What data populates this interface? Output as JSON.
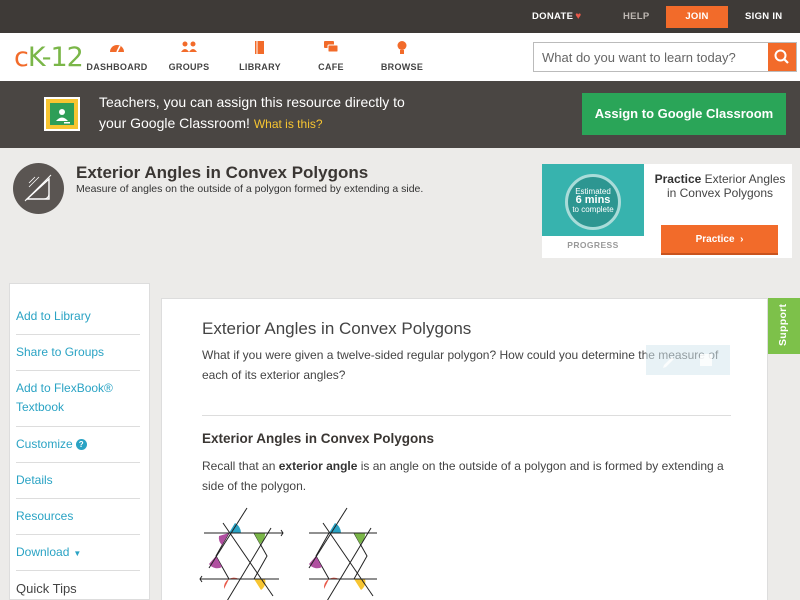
{
  "topbar": {
    "donate": "DONATE",
    "help": "HELP",
    "join": "JOIN",
    "sign_in": "SIGN IN"
  },
  "nav": {
    "logo_c": "c",
    "logo_k": "K",
    "logo_dash": "-",
    "logo_12": "12",
    "items": [
      {
        "label": "DASHBOARD",
        "icon": "dashboard-icon"
      },
      {
        "label": "GROUPS",
        "icon": "groups-icon"
      },
      {
        "label": "LIBRARY",
        "icon": "library-icon"
      },
      {
        "label": "CAFE",
        "icon": "cafe-icon"
      },
      {
        "label": "BROWSE",
        "icon": "browse-icon"
      }
    ],
    "search_placeholder": "What do you want to learn today?"
  },
  "classroom": {
    "line1": "Teachers, you can assign this resource directly to",
    "line2": "your Google Classroom!",
    "what": "What is this?",
    "button": "Assign to Google Classroom"
  },
  "header": {
    "title": "Exterior Angles in Convex Polygons",
    "subtitle": "Measure of angles on the outside of a polygon formed by extending a side."
  },
  "practice": {
    "estimated": "Estimated",
    "minutes": "6 mins",
    "to_complete": "to complete",
    "progress": "PROGRESS",
    "title_bold": "Practice",
    "title_rest": "Exterior Angles in Convex Polygons",
    "button": "Practice"
  },
  "sidebar": {
    "items": [
      {
        "label": "Add to Library"
      },
      {
        "label": "Share to Groups"
      },
      {
        "label": "Add to FlexBook® Textbook"
      },
      {
        "label": "Customize"
      },
      {
        "label": "Details"
      },
      {
        "label": "Resources"
      },
      {
        "label": "Download"
      },
      {
        "label": "Quick Tips"
      }
    ],
    "help_badge": "?",
    "dropdown_arrow": "▼"
  },
  "content": {
    "title": "Exterior Angles in Convex Polygons",
    "intro": "What if you were given a twelve-sided regular polygon? How could you determine the measure of each of its exterior angles?",
    "section_heading": "Exterior Angles in Convex Polygons",
    "para_before": "Recall that an ",
    "para_bold": "exterior angle",
    "para_after": " is an angle on the outside of a polygon and is formed by extending a side of the polygon."
  },
  "support": "Support",
  "colors": {
    "brand_orange": "#f26b2a",
    "brand_green": "#7ab648",
    "classroom_green": "#2aa558",
    "link_blue": "#2aa3c4"
  }
}
